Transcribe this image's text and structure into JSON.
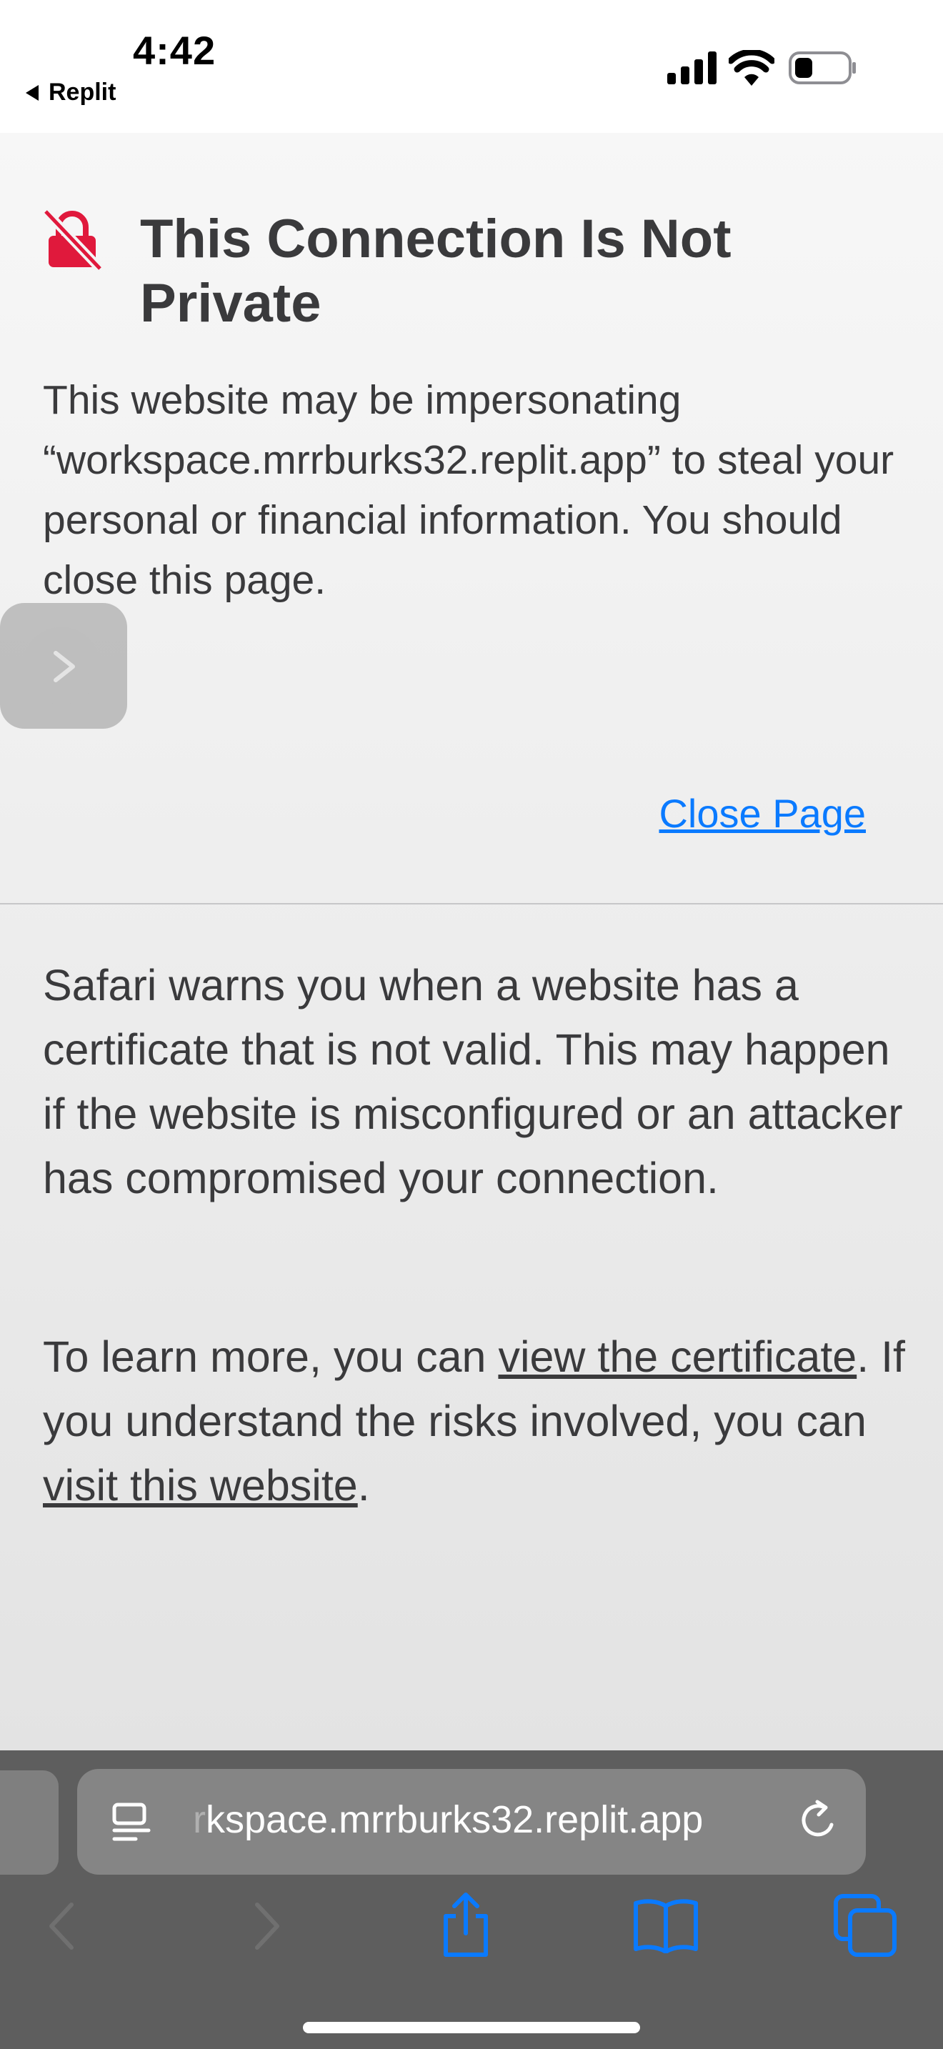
{
  "status_bar": {
    "time": "4:42",
    "back_app": "Replit"
  },
  "warning": {
    "title": "This Connection Is Not Private",
    "body": "This website may be impersonating “workspace.mrrburks32.replit.app” to steal your personal or financial information. You should close this page.",
    "close_label": "Close Page"
  },
  "info": {
    "paragraph1": "Safari warns you when a website has a certificate that is not valid. This may happen if the website is misconfigured or an attacker has compromised your connection.",
    "p2_prefix": "To learn more, you can ",
    "view_certificate_link": "view the certificate",
    "p2_middle": ". If you understand the risks involved, you can ",
    "visit_website_link": "visit this website",
    "p2_suffix": "."
  },
  "toolbar": {
    "url_faded": "r",
    "url_text": "kspace.mrrburks32.replit.app"
  },
  "icons": {
    "lock": "not-private-lock-icon",
    "page_menu": "page-menu-icon",
    "reload": "reload-icon",
    "back": "chevron-left-icon",
    "forward": "chevron-right-icon",
    "share": "share-icon",
    "bookmarks": "book-icon",
    "tabs": "tabs-icon"
  },
  "colors": {
    "accent": "#0a7aff",
    "warning_red": "#e0193c",
    "text": "#3a3a3c",
    "toolbar_bg": "#5e5e5e"
  }
}
